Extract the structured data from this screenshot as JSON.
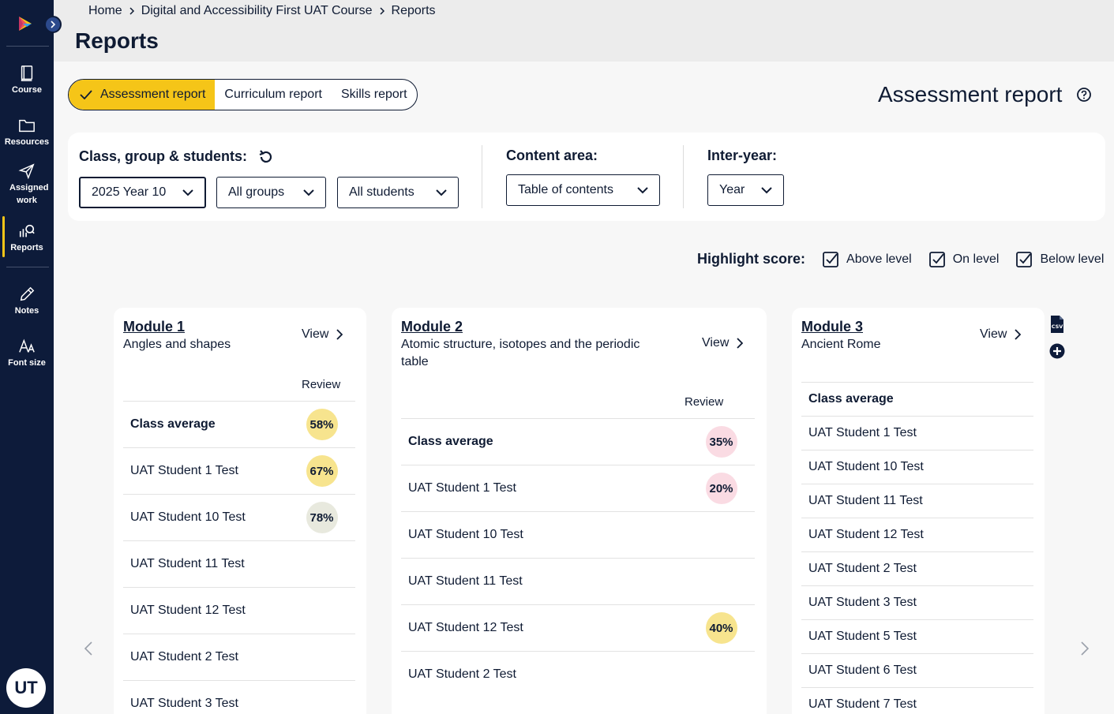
{
  "sidebar": {
    "items": [
      {
        "label": "Course",
        "icon": "book-icon"
      },
      {
        "label": "Resources",
        "icon": "folder-icon"
      },
      {
        "label": "Assigned work",
        "icon": "send-icon"
      },
      {
        "label": "Reports",
        "icon": "reports-icon"
      },
      {
        "label": "Notes",
        "icon": "pencil-icon"
      },
      {
        "label": "Font size",
        "icon": "font-size-icon"
      }
    ],
    "avatar": "UT"
  },
  "breadcrumb": [
    "Home",
    "Digital and Accessibility First UAT Course",
    "Reports"
  ],
  "page_title": "Reports",
  "report_tabs": [
    "Assessment report",
    "Curriculum report",
    "Skills report"
  ],
  "report_heading": "Assessment report",
  "filters": {
    "class_label": "Class, group & students:",
    "class_value": "2025 Year 10",
    "group_value": "All groups",
    "students_value": "All students",
    "content_label": "Content area:",
    "content_value": "Table of contents",
    "interyear_label": "Inter-year:",
    "interyear_value": "Year"
  },
  "highlight": {
    "label": "Highlight score:",
    "options": [
      "Above level",
      "On level",
      "Below level"
    ]
  },
  "colors": {
    "sidebar": "#0d1b3a",
    "accent": "#f5c518",
    "on_level": "#f7e48e",
    "above_level": "#e8e9de",
    "below_level": "#fadbe3"
  },
  "modules": [
    {
      "title": "Module 1",
      "subtitle": "Angles and shapes",
      "view": "View",
      "review": "Review",
      "rows": [
        {
          "name": "Class average",
          "score": "58%",
          "level": "on"
        },
        {
          "name": "UAT Student 1 Test",
          "score": "67%",
          "level": "on"
        },
        {
          "name": "UAT Student 10 Test",
          "score": "78%",
          "level": "above"
        },
        {
          "name": "UAT Student 11 Test",
          "score": ""
        },
        {
          "name": "UAT Student 12 Test",
          "score": ""
        },
        {
          "name": "UAT Student 2 Test",
          "score": ""
        },
        {
          "name": "UAT Student 3 Test",
          "score": ""
        }
      ]
    },
    {
      "title": "Module 2",
      "subtitle": "Atomic structure, isotopes and the periodic table",
      "view": "View",
      "review": "Review",
      "rows": [
        {
          "name": "Class average",
          "score": "35%",
          "level": "below"
        },
        {
          "name": "UAT Student 1 Test",
          "score": "20%",
          "level": "below"
        },
        {
          "name": "UAT Student 10 Test",
          "score": ""
        },
        {
          "name": "UAT Student 11 Test",
          "score": ""
        },
        {
          "name": "UAT Student 12 Test",
          "score": "40%",
          "level": "on"
        },
        {
          "name": "UAT Student 2 Test",
          "score": ""
        }
      ]
    },
    {
      "title": "Module 3",
      "subtitle": "Ancient Rome",
      "view": "View",
      "rows": [
        {
          "name": "Class average"
        },
        {
          "name": "UAT Student 1 Test"
        },
        {
          "name": "UAT Student 10 Test"
        },
        {
          "name": "UAT Student 11 Test"
        },
        {
          "name": "UAT Student 12 Test"
        },
        {
          "name": "UAT Student 2 Test"
        },
        {
          "name": "UAT Student 3 Test"
        },
        {
          "name": "UAT Student 5 Test"
        },
        {
          "name": "UAT Student 6 Test"
        },
        {
          "name": "UAT Student 7 Test"
        }
      ]
    }
  ]
}
